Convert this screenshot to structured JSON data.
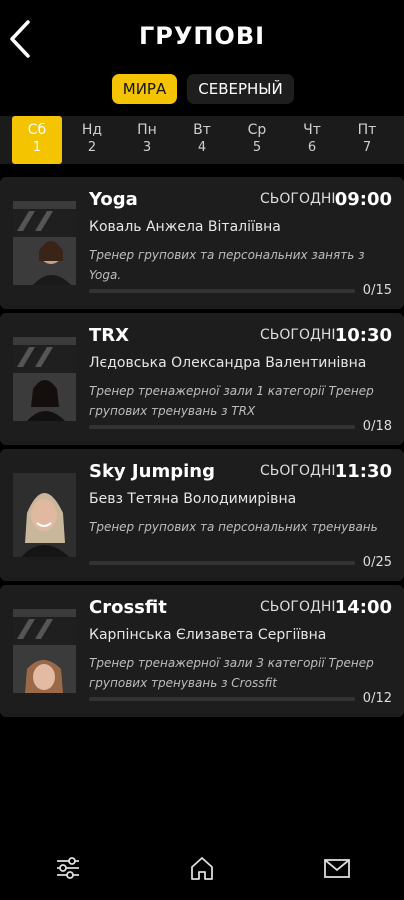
{
  "header": {
    "title": "ГРУПОВІ",
    "back_icon": "chevron-left-icon"
  },
  "locations": [
    {
      "label": "МИРА",
      "active": true
    },
    {
      "label": "СЕВЕРНЫЙ",
      "active": false
    }
  ],
  "days": [
    {
      "name": "Сб",
      "num": "1",
      "active": true
    },
    {
      "name": "Нд",
      "num": "2"
    },
    {
      "name": "Пн",
      "num": "3"
    },
    {
      "name": "Вт",
      "num": "4"
    },
    {
      "name": "Ср",
      "num": "5"
    },
    {
      "name": "Чт",
      "num": "6"
    },
    {
      "name": "Пт",
      "num": "7"
    }
  ],
  "classes": [
    {
      "name": "Yoga",
      "day_label": "СЬОГОДНІ",
      "time": "09:00",
      "trainer": "Коваль Анжела Віталіївна",
      "description": "Тренер групових та персональних занять з Yoga.",
      "count": "0/15",
      "fill_fraction": 0
    },
    {
      "name": "TRX",
      "day_label": "СЬОГОДНІ",
      "time": "10:30",
      "trainer": "Лєдовська Олександра Валентинівна",
      "description": "Тренер тренажерної зали 1 категорії Тренер групових тренувань з TRX",
      "count": "0/18",
      "fill_fraction": 0
    },
    {
      "name": "Sky Jumping",
      "day_label": "СЬОГОДНІ",
      "time": "11:30",
      "trainer": "Бевз Тетяна Володимирівна",
      "description": "Тренер групових та персональних тренувань",
      "count": "0/25",
      "fill_fraction": 0
    },
    {
      "name": "Crossfit",
      "day_label": "СЬОГОДНІ",
      "time": "14:00",
      "trainer": "Карпінська Єлизавета Сергіївна",
      "description": "Тренер тренажерної зали 3 категорії Тренер групових тренувань з Crossfit",
      "count": "0/12",
      "fill_fraction": 0
    }
  ],
  "bottom_nav": [
    "filter-icon",
    "home-icon",
    "mail-icon"
  ],
  "colors": {
    "accent": "#f5c400",
    "card": "#1d1d1d",
    "background": "#000000"
  }
}
